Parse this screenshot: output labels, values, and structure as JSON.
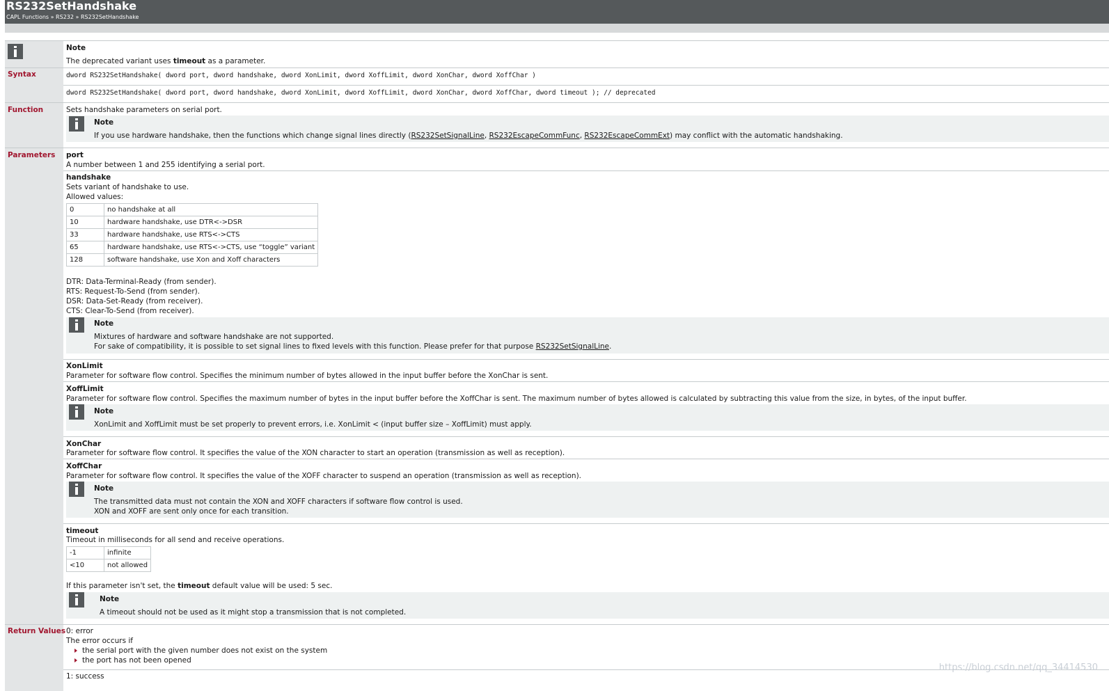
{
  "header": {
    "title": "RS232SetHandshake",
    "breadcrumb": "CAPL Functions » RS232 » RS232SetHandshake"
  },
  "top_note": {
    "title": "Note",
    "text_before": "The deprecated variant uses ",
    "text_bold": "timeout",
    "text_after": " as a parameter."
  },
  "syntax": {
    "label": "Syntax",
    "line1": "dword RS232SetHandshake( dword port, dword handshake, dword XonLimit, dword XoffLimit, dword XonChar, dword XoffChar )",
    "line2": "dword RS232SetHandshake( dword port, dword handshake, dword XonLimit, dword XoffLimit, dword XonChar, dword XoffChar, dword timeout ); // deprecated"
  },
  "function": {
    "label": "Function",
    "text": "Sets handshake parameters on serial port.",
    "note_title": "Note",
    "note_before": "If you use hardware handshake, then the functions which change signal lines directly (",
    "link1": "RS232SetSignalLine",
    "sep1": ", ",
    "link2": "RS232EscapeCommFunc",
    "sep2": ", ",
    "link3": "RS232EscapeCommExt",
    "note_after": ") may conflict with the automatic handshaking."
  },
  "parameters": {
    "label": "Parameters",
    "port": {
      "name": "port",
      "desc": "A number between 1 and 255 identifying a serial port."
    },
    "handshake": {
      "name": "handshake",
      "desc": "Sets variant of handshake to use.",
      "allowed": "Allowed values:",
      "rows": [
        {
          "value": "0",
          "meaning": "no handshake at all"
        },
        {
          "value": "10",
          "meaning": "hardware handshake, use DTR<->DSR"
        },
        {
          "value": "33",
          "meaning": "hardware handshake, use RTS<->CTS"
        },
        {
          "value": "65",
          "meaning": "hardware handshake, use RTS<->CTS, use “toggle” variant"
        },
        {
          "value": "128",
          "meaning": "software handshake, use Xon and Xoff characters"
        }
      ],
      "abbr": [
        "DTR: Data-Terminal-Ready (from sender).",
        "RTS: Request-To-Send (from sender).",
        "DSR: Data-Set-Ready (from receiver).",
        "CTS: Clear-To-Send (from receiver)."
      ],
      "note_title": "Note",
      "note_line1": "Mixtures of hardware and software handshake are not supported.",
      "note_line2_before": "For sake of compatibility, it is possible to set signal lines to fixed levels with this function. Please prefer for that purpose ",
      "note_link": "RS232SetSignalLine",
      "note_line2_after": "."
    },
    "xonlimit": {
      "name": "XonLimit",
      "desc": "Parameter for software flow control. Specifies the minimum number of bytes allowed in the input buffer before the XonChar is sent."
    },
    "xofflimit": {
      "name": "XoffLimit",
      "desc": "Parameter for software flow control. Specifies the maximum number of bytes in the input buffer before the XoffChar is sent. The maximum number of bytes allowed is calculated by subtracting this value from the size, in bytes, of the input buffer.",
      "note_title": "Note",
      "note_text": "XonLimit and XoffLimit must be set properly to prevent errors, i.e. XonLimit < (input buffer size – XoffLimit) must apply."
    },
    "xonchar": {
      "name": "XonChar",
      "desc": "Parameter for software flow control. It specifies the value of the XON character to start an operation (transmission as well as reception)."
    },
    "xoffchar": {
      "name": "XoffChar",
      "desc": "Parameter for software flow control. It specifies the value of the XOFF character to suspend an operation (transmission as well as reception).",
      "note_title": "Note",
      "note_line1": "The transmitted data must not contain the XON and XOFF characters if software flow control is used.",
      "note_line2": "XON and XOFF are sent only once for each transition."
    },
    "timeout": {
      "name": "timeout",
      "desc": "Timeout in milliseconds for all send and receive operations.",
      "rows": [
        {
          "value": "-1",
          "meaning": "infinite"
        },
        {
          "value": "<10",
          "meaning": "not allowed"
        }
      ],
      "default_before": "If this parameter isn't set, the ",
      "default_bold": "timeout",
      "default_after": " default value will be used: 5 sec.",
      "note_title": "Note",
      "note_text": "A timeout should not be used as it might stop a transmission that is not completed."
    }
  },
  "return_values": {
    "label": "Return Values",
    "error": "0: error",
    "occurs": "The error occurs if",
    "bullets": [
      "the serial port with the given number does not exist on the system",
      "the port has not been opened"
    ],
    "success": "1: success"
  },
  "watermark": "https://blog.csdn.net/qq_34414530"
}
